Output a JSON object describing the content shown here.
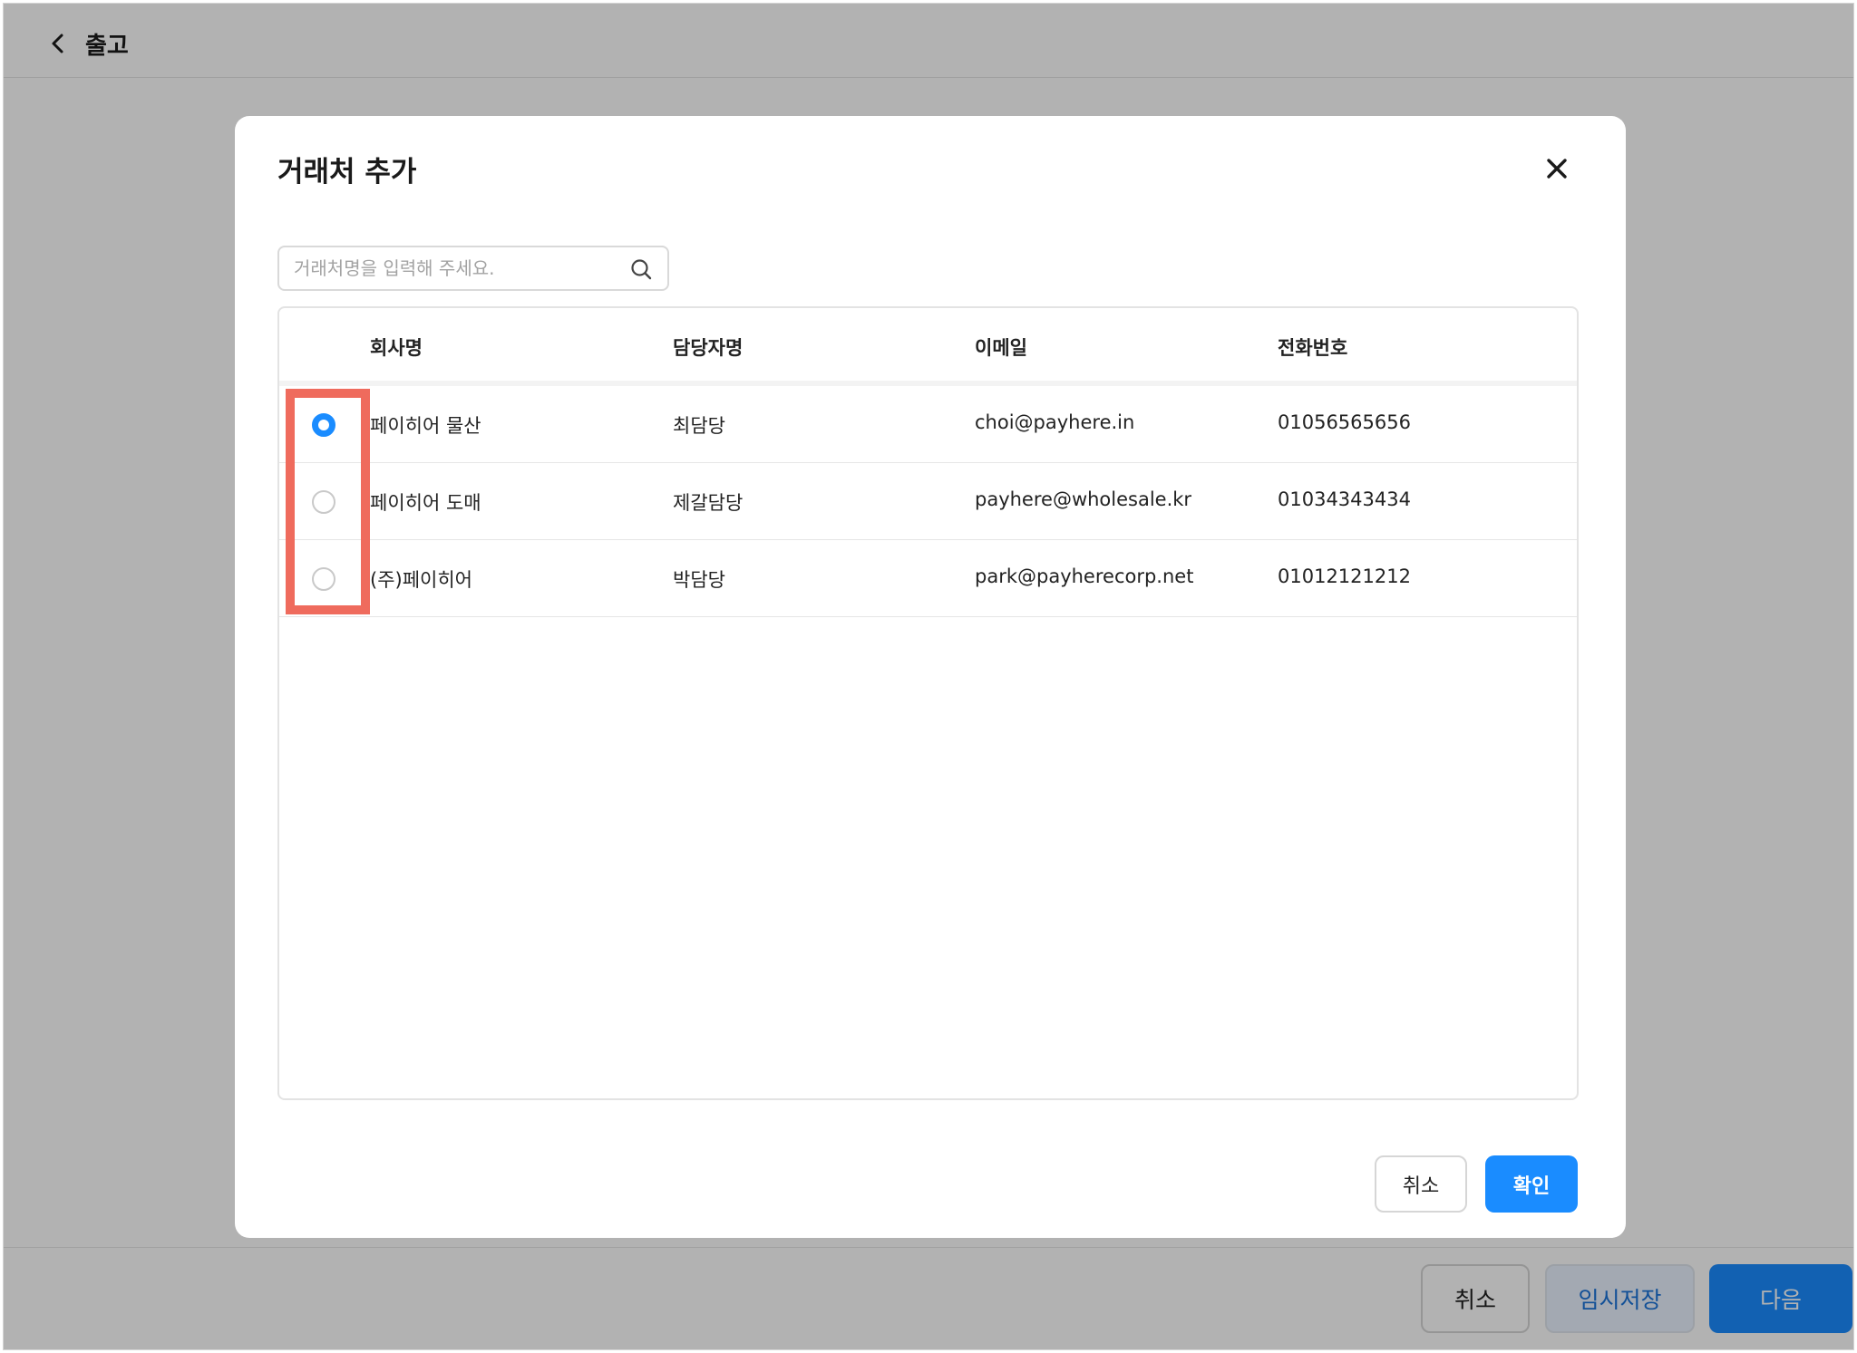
{
  "page": {
    "title": "출고",
    "footer": {
      "cancel_label": "취소",
      "draft_label": "임시저장",
      "next_label": "다음"
    }
  },
  "modal": {
    "title": "거래처 추가",
    "search": {
      "placeholder": "거래처명을 입력해 주세요.",
      "value": ""
    },
    "table": {
      "columns": [
        "회사명",
        "담당자명",
        "이메일",
        "전화번호"
      ],
      "rows": [
        {
          "company": "페이히어 물산",
          "manager": "최담당",
          "email": "choi@payhere.in",
          "phone": "01056565656",
          "selected": true
        },
        {
          "company": "페이히어 도매",
          "manager": "제갈담당",
          "email": "payhere@wholesale.kr",
          "phone": "01034343434",
          "selected": false
        },
        {
          "company": "(주)페이히어",
          "manager": "박담당",
          "email": "park@payherecorp.net",
          "phone": "01012121212",
          "selected": false
        }
      ]
    },
    "cancel_label": "취소",
    "confirm_label": "확인"
  },
  "colors": {
    "accent": "#1a8cff",
    "highlight": "#ef6b5d",
    "overlay": "rgba(0,0,0,0.30)"
  },
  "icons": {
    "back": "chevron-left-icon",
    "close": "close-icon",
    "search": "search-icon"
  }
}
